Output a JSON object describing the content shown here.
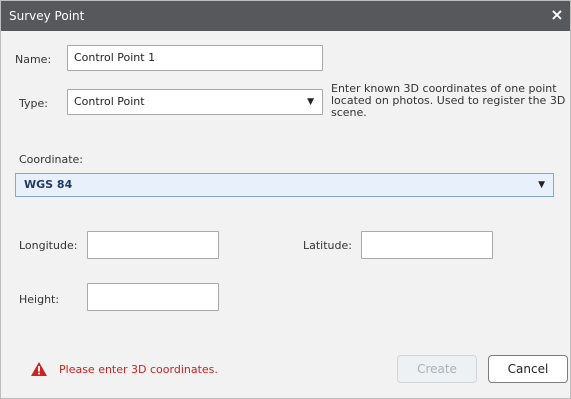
{
  "dialog": {
    "title": "Survey Point",
    "close_glyph": "×"
  },
  "form": {
    "name_label": "Name:",
    "name_value": "Control Point 1",
    "type_label": "Type:",
    "type_value": "Control Point",
    "help_text": "Enter known 3D coordinates of one point located on photos. Used to register the 3D scene.",
    "coordinate_label": "Coordinate:",
    "coordinate_value": "WGS 84",
    "longitude_label": "Longitude:",
    "longitude_value": "",
    "latitude_label": "Latitude:",
    "latitude_value": "",
    "height_label": "Height:",
    "height_value": ""
  },
  "footer": {
    "error_message": "Please enter 3D coordinates.",
    "create_label": "Create",
    "cancel_label": "Cancel"
  },
  "colors": {
    "titlebar": "#56585c",
    "error": "#cc2222",
    "select_highlight": "#e8f0fb"
  }
}
